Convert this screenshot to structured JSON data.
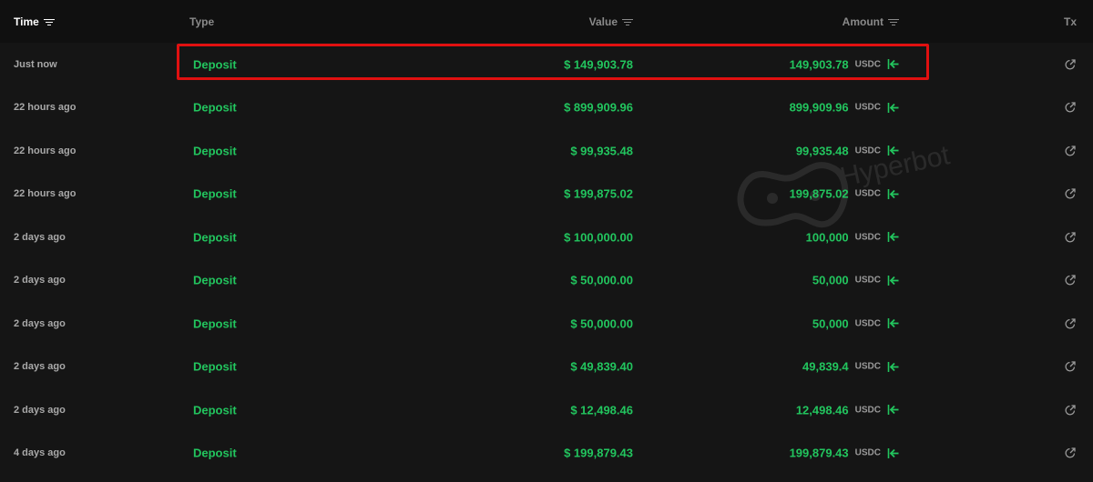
{
  "colors": {
    "background": "#151515",
    "header_background": "#101010",
    "green": "#22c55e",
    "highlight_border": "#e01010",
    "muted_text": "#a9a9a9"
  },
  "header": {
    "time": "Time",
    "type": "Type",
    "value": "Value",
    "amount": "Amount",
    "tx": "Tx"
  },
  "rows": [
    {
      "time": "Just now",
      "type": "Deposit",
      "value": "$ 149,903.78",
      "amount": "149,903.78",
      "unit": "USDC"
    },
    {
      "time": "22 hours ago",
      "type": "Deposit",
      "value": "$ 899,909.96",
      "amount": "899,909.96",
      "unit": "USDC"
    },
    {
      "time": "22 hours ago",
      "type": "Deposit",
      "value": "$ 99,935.48",
      "amount": "99,935.48",
      "unit": "USDC"
    },
    {
      "time": "22 hours ago",
      "type": "Deposit",
      "value": "$ 199,875.02",
      "amount": "199,875.02",
      "unit": "USDC"
    },
    {
      "time": "2 days ago",
      "type": "Deposit",
      "value": "$ 100,000.00",
      "amount": "100,000",
      "unit": "USDC"
    },
    {
      "time": "2 days ago",
      "type": "Deposit",
      "value": "$ 50,000.00",
      "amount": "50,000",
      "unit": "USDC"
    },
    {
      "time": "2 days ago",
      "type": "Deposit",
      "value": "$ 50,000.00",
      "amount": "50,000",
      "unit": "USDC"
    },
    {
      "time": "2 days ago",
      "type": "Deposit",
      "value": "$ 49,839.40",
      "amount": "49,839.4",
      "unit": "USDC"
    },
    {
      "time": "2 days ago",
      "type": "Deposit",
      "value": "$ 12,498.46",
      "amount": "12,498.46",
      "unit": "USDC"
    },
    {
      "time": "4 days ago",
      "type": "Deposit",
      "value": "$ 199,879.43",
      "amount": "199,879.43",
      "unit": "USDC"
    }
  ],
  "icons": {
    "sort": "filter-lines-icon",
    "direction": "arrow-left-bar-icon",
    "tx_link": "external-link-icon"
  },
  "watermark": {
    "text": "Hyperbot"
  }
}
